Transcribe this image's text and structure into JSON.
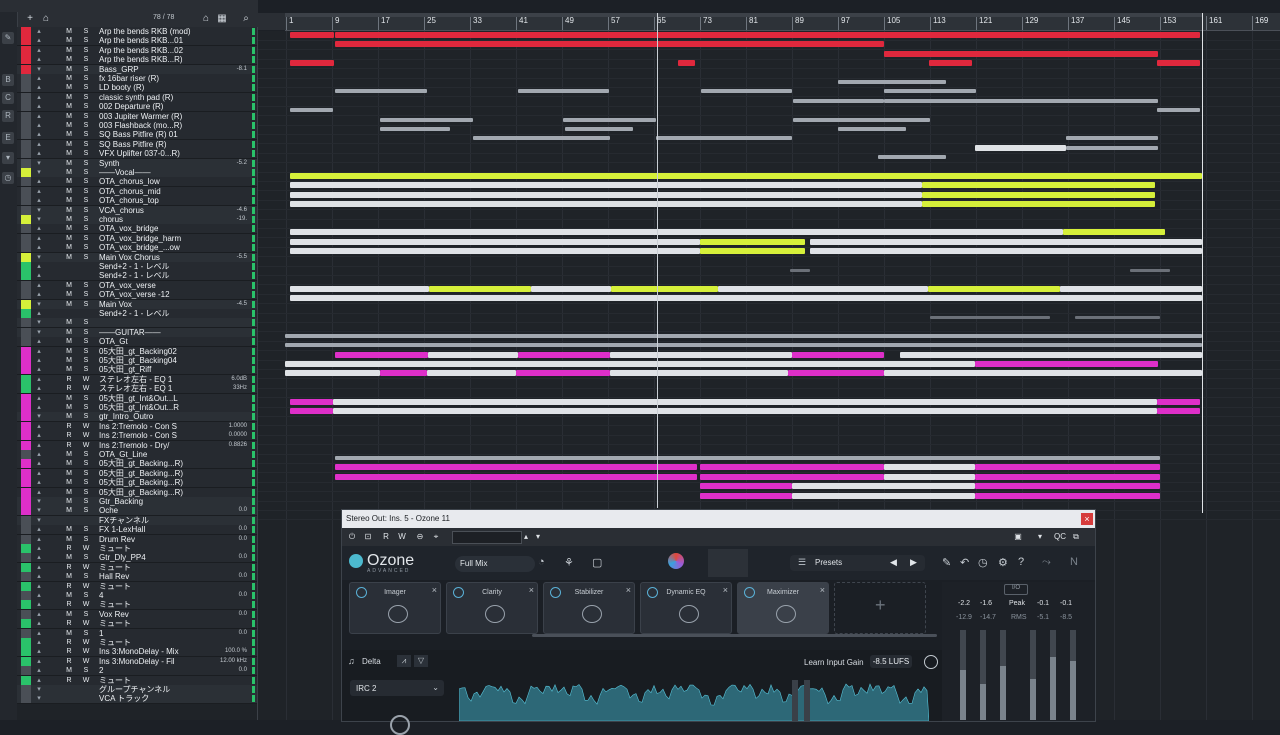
{
  "toolbar": {
    "add_icon": "+",
    "track_counter": "78 / 78",
    "search_icon": "⌕",
    "house_icon": "⌂",
    "grid_icon": "▦",
    "hamburger_icon": "≡"
  },
  "ruler": {
    "bars": [
      "1",
      "9",
      "17",
      "25",
      "33",
      "41",
      "49",
      "57",
      "65",
      "73",
      "81",
      "89",
      "97",
      "105",
      "113",
      "121",
      "129",
      "137",
      "145",
      "153",
      "161",
      "169"
    ]
  },
  "tracks": [
    {
      "name": "Arp the bends RKB (mod)",
      "m": "M",
      "s": "S",
      "color": "#e0283d",
      "val": "",
      "sub": true
    },
    {
      "name": "Arp the bends RKB...01",
      "m": "M",
      "s": "S",
      "color": "#e0283d",
      "val": "",
      "sub": true
    },
    {
      "name": "Arp the bends RKB...02",
      "m": "M",
      "s": "S",
      "color": "#e0283d",
      "val": "",
      "sub": true
    },
    {
      "name": "Arp the bends RKB...R)",
      "m": "M",
      "s": "S",
      "color": "#e0283d",
      "val": "",
      "sub": true
    },
    {
      "name": "Bass_GRP",
      "m": "M",
      "s": "S",
      "color": "#e0283d",
      "val": "-8.1",
      "sub": false
    },
    {
      "name": "fx 16bar riser (R)",
      "m": "M",
      "s": "S",
      "color": "#4a4f56",
      "val": "",
      "sub": true
    },
    {
      "name": "LD booty (R)",
      "m": "M",
      "s": "S",
      "color": "#4a4f56",
      "val": "",
      "sub": true
    },
    {
      "name": "classic synth pad (R)",
      "m": "M",
      "s": "S",
      "color": "#4a4f56",
      "val": "",
      "sub": true
    },
    {
      "name": "002 Departure (R)",
      "m": "M",
      "s": "S",
      "color": "#4a4f56",
      "val": "",
      "sub": true
    },
    {
      "name": "003 Jupiter Warmer (R)",
      "m": "M",
      "s": "S",
      "color": "#4a4f56",
      "val": "",
      "sub": true
    },
    {
      "name": "003 Flashback (mo...R)",
      "m": "M",
      "s": "S",
      "color": "#4a4f56",
      "val": "",
      "sub": true
    },
    {
      "name": "SQ Bass Pitfire (R) 01",
      "m": "M",
      "s": "S",
      "color": "#4a4f56",
      "val": "",
      "sub": true
    },
    {
      "name": "SQ Bass Pitfire (R)",
      "m": "M",
      "s": "S",
      "color": "#4a4f56",
      "val": "",
      "sub": true
    },
    {
      "name": "VFX Uplifter 037-0...R)",
      "m": "M",
      "s": "S",
      "color": "#4a4f56",
      "val": "",
      "sub": true
    },
    {
      "name": "Synth",
      "m": "M",
      "s": "S",
      "color": "#4a4f56",
      "val": "-5.2",
      "sub": false
    },
    {
      "name": "——Vocal——",
      "m": "M",
      "s": "S",
      "color": "#d6f03a",
      "val": "",
      "sub": false
    },
    {
      "name": "OTA_chorus_low",
      "m": "M",
      "s": "S",
      "color": "#4a4f56",
      "val": "",
      "sub": true
    },
    {
      "name": "OTA_chorus_mid",
      "m": "M",
      "s": "S",
      "color": "#4a4f56",
      "val": "",
      "sub": true
    },
    {
      "name": "OTA_chorus_top",
      "m": "M",
      "s": "S",
      "color": "#4a4f56",
      "val": "",
      "sub": true
    },
    {
      "name": "VCA_chorus",
      "m": "M",
      "s": "S",
      "color": "#4a4f56",
      "val": "-4.6",
      "sub": false
    },
    {
      "name": "chorus",
      "m": "M",
      "s": "S",
      "color": "#d6f03a",
      "val": "-19.",
      "sub": false
    },
    {
      "name": "OTA_vox_bridge",
      "m": "M",
      "s": "S",
      "color": "#4a4f56",
      "val": "",
      "sub": true
    },
    {
      "name": "OTA_vox_bridge_harm",
      "m": "M",
      "s": "S",
      "color": "#4a4f56",
      "val": "",
      "sub": true
    },
    {
      "name": "OTA_vox_bridge_...ow",
      "m": "M",
      "s": "S",
      "color": "#4a4f56",
      "val": "",
      "sub": true
    },
    {
      "name": "Main Vox Chorus",
      "m": "M",
      "s": "S",
      "color": "#d6f03a",
      "val": "-5.5",
      "sub": false
    },
    {
      "name": "Send+2 - 1 - レベル",
      "m": "",
      "s": "",
      "color": "#2ac26a",
      "val": "",
      "sub": true
    },
    {
      "name": "Send+2 - 1 - レベル",
      "m": "",
      "s": "",
      "color": "#2ac26a",
      "val": "",
      "sub": true
    },
    {
      "name": "OTA_vox_verse",
      "m": "M",
      "s": "S",
      "color": "#4a4f56",
      "val": "",
      "sub": true
    },
    {
      "name": "OTA_vox_verse -12",
      "m": "M",
      "s": "S",
      "color": "#4a4f56",
      "val": "",
      "sub": true
    },
    {
      "name": "Main Vox",
      "m": "M",
      "s": "S",
      "color": "#d6f03a",
      "val": "-4.5",
      "sub": false
    },
    {
      "name": "Send+2 - 1 - レベル",
      "m": "",
      "s": "",
      "color": "#2ac26a",
      "val": "",
      "sub": true
    },
    {
      "name": "",
      "m": "M",
      "s": "S",
      "color": "#4a4f56",
      "val": "",
      "sub": false
    },
    {
      "name": "——GUITAR——",
      "m": "M",
      "s": "S",
      "color": "#4a4f56",
      "val": "",
      "sub": false
    },
    {
      "name": "OTA_Gt",
      "m": "M",
      "s": "S",
      "color": "#4a4f56",
      "val": "",
      "sub": true
    },
    {
      "name": "05大田_gt_Backing02",
      "m": "M",
      "s": "S",
      "color": "#de2fc9",
      "val": "",
      "sub": true
    },
    {
      "name": "05大田_gt_Backing04",
      "m": "M",
      "s": "S",
      "color": "#de2fc9",
      "val": "",
      "sub": true
    },
    {
      "name": "05大田_gt_Riff",
      "m": "M",
      "s": "S",
      "color": "#de2fc9",
      "val": "",
      "sub": true
    },
    {
      "name": "ステレオ左右 - EQ 1",
      "m": "R",
      "s": "W",
      "color": "#2ac26a",
      "val": "6.0dB",
      "sub": true
    },
    {
      "name": "ステレオ左右 - EQ 1",
      "m": "R",
      "s": "W",
      "color": "#2ac26a",
      "val": "33Hz",
      "sub": true
    },
    {
      "name": "05大田_gt_Int&Out...L",
      "m": "M",
      "s": "S",
      "color": "#de2fc9",
      "val": "",
      "sub": true
    },
    {
      "name": "05大田_gt_Int&Out...R",
      "m": "M",
      "s": "S",
      "color": "#de2fc9",
      "val": "",
      "sub": true
    },
    {
      "name": "gtr_Intro_Outro",
      "m": "M",
      "s": "S",
      "color": "#de2fc9",
      "val": "",
      "sub": false
    },
    {
      "name": "Ins 2:Tremolo - Con S",
      "m": "R",
      "s": "W",
      "color": "#de2fc9",
      "val": "1.0000",
      "sub": true
    },
    {
      "name": "Ins 2:Tremolo - Con S",
      "m": "R",
      "s": "W",
      "color": "#de2fc9",
      "val": "0.0000",
      "sub": true
    },
    {
      "name": "Ins 2:Tremolo - Dry/",
      "m": "R",
      "s": "W",
      "color": "#de2fc9",
      "val": "0.8826",
      "sub": true
    },
    {
      "name": "OTA_Gt_Line",
      "m": "M",
      "s": "S",
      "color": "#4a4f56",
      "val": "",
      "sub": true
    },
    {
      "name": "05大田_gt_Backing...R)",
      "m": "M",
      "s": "S",
      "color": "#de2fc9",
      "val": "",
      "sub": true
    },
    {
      "name": "05大田_gt_Backing...R)",
      "m": "M",
      "s": "S",
      "color": "#de2fc9",
      "val": "",
      "sub": true
    },
    {
      "name": "05大田_gt_Backing...R)",
      "m": "M",
      "s": "S",
      "color": "#de2fc9",
      "val": "",
      "sub": true
    },
    {
      "name": "05大田_gt_Backing...R)",
      "m": "M",
      "s": "S",
      "color": "#de2fc9",
      "val": "",
      "sub": true
    },
    {
      "name": "Gtr_Backing",
      "m": "M",
      "s": "S",
      "color": "#de2fc9",
      "val": "",
      "sub": false
    },
    {
      "name": "Oche",
      "m": "M",
      "s": "S",
      "color": "#de2fc9",
      "val": "0.0",
      "sub": false
    },
    {
      "name": "FXチャンネル",
      "m": "",
      "s": "",
      "color": "#4a4f56",
      "val": "",
      "sub": false
    },
    {
      "name": "FX 1-LexHall",
      "m": "M",
      "s": "S",
      "color": "#4a4f56",
      "val": "0.0",
      "sub": true
    },
    {
      "name": "Drum Rev",
      "m": "M",
      "s": "S",
      "color": "#4a4f56",
      "val": "0.0",
      "sub": true
    },
    {
      "name": "ミュート",
      "m": "R",
      "s": "W",
      "color": "#2ac26a",
      "val": "",
      "sub": true
    },
    {
      "name": "Gtr_Dly_PP4",
      "m": "M",
      "s": "S",
      "color": "#4a4f56",
      "val": "0.0",
      "sub": true
    },
    {
      "name": "ミュート",
      "m": "R",
      "s": "W",
      "color": "#2ac26a",
      "val": "",
      "sub": true
    },
    {
      "name": "Hall Rev",
      "m": "M",
      "s": "S",
      "color": "#4a4f56",
      "val": "0.0",
      "sub": true
    },
    {
      "name": "ミュート",
      "m": "R",
      "s": "W",
      "color": "#2ac26a",
      "val": "",
      "sub": true
    },
    {
      "name": "4",
      "m": "M",
      "s": "S",
      "color": "#4a4f56",
      "val": "0.0",
      "sub": true
    },
    {
      "name": "ミュート",
      "m": "R",
      "s": "W",
      "color": "#2ac26a",
      "val": "",
      "sub": true
    },
    {
      "name": "Vox Rev",
      "m": "M",
      "s": "S",
      "color": "#4a4f56",
      "val": "0.0",
      "sub": true
    },
    {
      "name": "ミュート",
      "m": "R",
      "s": "W",
      "color": "#2ac26a",
      "val": "",
      "sub": true
    },
    {
      "name": "1",
      "m": "M",
      "s": "S",
      "color": "#4a4f56",
      "val": "0.0",
      "sub": true
    },
    {
      "name": "ミュート",
      "m": "R",
      "s": "W",
      "color": "#2ac26a",
      "val": "",
      "sub": true
    },
    {
      "name": "Ins 3:MonoDelay - Mix",
      "m": "R",
      "s": "W",
      "color": "#2ac26a",
      "val": "100.0 %",
      "sub": true
    },
    {
      "name": "Ins 3:MonoDelay - Fil",
      "m": "R",
      "s": "W",
      "color": "#2ac26a",
      "val": "12.00 kHz",
      "sub": true
    },
    {
      "name": "2",
      "m": "M",
      "s": "S",
      "color": "#4a4f56",
      "val": "0.0",
      "sub": true
    },
    {
      "name": "ミュート",
      "m": "R",
      "s": "W",
      "color": "#2ac26a",
      "val": "",
      "sub": true
    },
    {
      "name": "グループチャンネル",
      "m": "",
      "s": "",
      "color": "#4a4f56",
      "val": "",
      "sub": false
    },
    {
      "name": "VCA トラック",
      "m": "",
      "s": "",
      "color": "#4a4f56",
      "val": "",
      "sub": false
    }
  ],
  "lanes": [
    [
      [
        "red",
        290,
        334
      ],
      [
        "red",
        335,
        1200
      ]
    ],
    [
      [
        "red",
        335,
        884
      ]
    ],
    [
      [
        "red",
        884,
        1158
      ]
    ],
    [
      [
        "red",
        290,
        334
      ],
      [
        "red",
        678,
        695
      ],
      [
        "red",
        929,
        972
      ],
      [
        "red",
        1157,
        1200
      ]
    ],
    [],
    [
      [
        "gray",
        838,
        946
      ]
    ],
    [
      [
        "gray",
        335,
        427
      ],
      [
        "gray",
        518,
        609
      ],
      [
        "gray",
        701,
        792
      ],
      [
        "gray",
        884,
        976
      ]
    ],
    [
      [
        "gray",
        793,
        884
      ],
      [
        "gray",
        884,
        1158
      ]
    ],
    [
      [
        "gray",
        290,
        333
      ],
      [
        "gray",
        1157,
        1200
      ]
    ],
    [
      [
        "gray",
        380,
        473
      ],
      [
        "gray",
        563,
        656
      ],
      [
        "gray",
        793,
        930
      ]
    ],
    [
      [
        "gray",
        380,
        450
      ],
      [
        "gray",
        565,
        633
      ],
      [
        "gray",
        838,
        906
      ]
    ],
    [
      [
        "gray",
        473,
        610
      ],
      [
        "gray",
        656,
        792
      ],
      [
        "gray",
        1066,
        1158
      ]
    ],
    [
      [
        "white",
        975,
        1066
      ],
      [
        "gray",
        1066,
        1158
      ]
    ],
    [
      [
        "gray",
        878,
        946
      ]
    ],
    [],
    [
      [
        "lime",
        290,
        1202
      ]
    ],
    [
      [
        "white",
        290,
        922
      ],
      [
        "lime",
        922,
        1155
      ]
    ],
    [
      [
        "white",
        290,
        922
      ],
      [
        "lime",
        922,
        1155
      ]
    ],
    [
      [
        "white",
        290,
        922
      ],
      [
        "lime",
        922,
        1155
      ]
    ],
    [],
    [],
    [
      [
        "white",
        290,
        1063
      ],
      [
        "lime",
        1063,
        1165
      ]
    ],
    [
      [
        "white",
        290,
        700
      ],
      [
        "lime",
        700,
        805
      ],
      [
        "white",
        810,
        1202
      ]
    ],
    [
      [
        "white",
        290,
        700
      ],
      [
        "lime",
        700,
        805
      ],
      [
        "white",
        810,
        1202
      ]
    ],
    [],
    [
      [
        "dim",
        790,
        810
      ],
      [
        "dim",
        1130,
        1170
      ]
    ],
    [],
    [
      [
        "white",
        290,
        429
      ],
      [
        "lime",
        429,
        531
      ],
      [
        "white",
        531,
        611
      ],
      [
        "lime",
        611,
        718
      ],
      [
        "white",
        718,
        928
      ],
      [
        "lime",
        928,
        1060
      ],
      [
        "white",
        1060,
        1202
      ]
    ],
    [
      [
        "white",
        290,
        1202
      ]
    ],
    [],
    [
      [
        "dim",
        930,
        1050
      ],
      [
        "dim",
        1075,
        1160
      ]
    ],
    [],
    [
      [
        "gray",
        285,
        1202
      ]
    ],
    [
      [
        "gray",
        285,
        1202
      ]
    ],
    [
      [
        "mag",
        335,
        428
      ],
      [
        "white",
        428,
        518
      ],
      [
        "mag",
        518,
        610
      ],
      [
        "white",
        610,
        792
      ],
      [
        "mag",
        792,
        884
      ],
      [
        "white",
        900,
        1202
      ]
    ],
    [
      [
        "white",
        285,
        975
      ],
      [
        "mag",
        975,
        1158
      ]
    ],
    [
      [
        "white",
        285,
        380
      ],
      [
        "mag",
        380,
        427
      ],
      [
        "white",
        427,
        516
      ],
      [
        "mag",
        516,
        610
      ],
      [
        "white",
        610,
        788
      ],
      [
        "mag",
        788,
        884
      ],
      [
        "white",
        884,
        1202
      ]
    ],
    [],
    [],
    [
      [
        "mag",
        290,
        333
      ],
      [
        "white",
        333,
        1157
      ],
      [
        "mag",
        1157,
        1200
      ]
    ],
    [
      [
        "mag",
        290,
        333
      ],
      [
        "white",
        333,
        1157
      ],
      [
        "mag",
        1157,
        1200
      ]
    ],
    [],
    [],
    [],
    [],
    [
      [
        "gray",
        335,
        1160
      ]
    ],
    [
      [
        "mag",
        335,
        697
      ],
      [
        "mag",
        700,
        884
      ],
      [
        "white",
        884,
        975
      ],
      [
        "mag",
        975,
        1160
      ]
    ],
    [
      [
        "mag",
        335,
        697
      ],
      [
        "mag",
        700,
        884
      ],
      [
        "white",
        884,
        975
      ],
      [
        "mag",
        975,
        1160
      ]
    ],
    [
      [
        "mag",
        700,
        792
      ],
      [
        "white",
        792,
        975
      ],
      [
        "mag",
        975,
        1160
      ]
    ],
    [
      [
        "mag",
        700,
        792
      ],
      [
        "white",
        792,
        975
      ],
      [
        "mag",
        975,
        1160
      ]
    ],
    [],
    []
  ],
  "ozone": {
    "window_title": "Stereo Out: Ins. 5 - Ozone 11",
    "close": "×",
    "product_name": "Ozone",
    "product_edition": "ADVANCED",
    "full_mix": "Full Mix",
    "presets": "Presets",
    "modules": [
      {
        "name": "Imager",
        "active": false
      },
      {
        "name": "Clarity",
        "active": false
      },
      {
        "name": "Stabilizer",
        "active": false
      },
      {
        "name": "Dynamic EQ",
        "active": false
      },
      {
        "name": "Maximizer",
        "active": true
      }
    ],
    "add_module": "+",
    "delta": "Delta",
    "learn_input_gain": "Learn Input Gain",
    "lufs": "-8.5 LUFS",
    "irc": "IRC 2",
    "meters": {
      "in_l": "-2.2",
      "in_r": "-1.6",
      "peak_label": "Peak",
      "out_l": "-0.1",
      "out_r": "-0.1",
      "in_rms_l": "-12.9",
      "in_rms_r": "-14.7",
      "rms_label": "RMS",
      "out_rms_l": "-5.1",
      "out_rms_r": "-8.5",
      "io_label": "I/O",
      "levels": [
        0.55,
        0.4,
        0.6,
        0.45,
        0.7,
        0.65
      ]
    }
  }
}
